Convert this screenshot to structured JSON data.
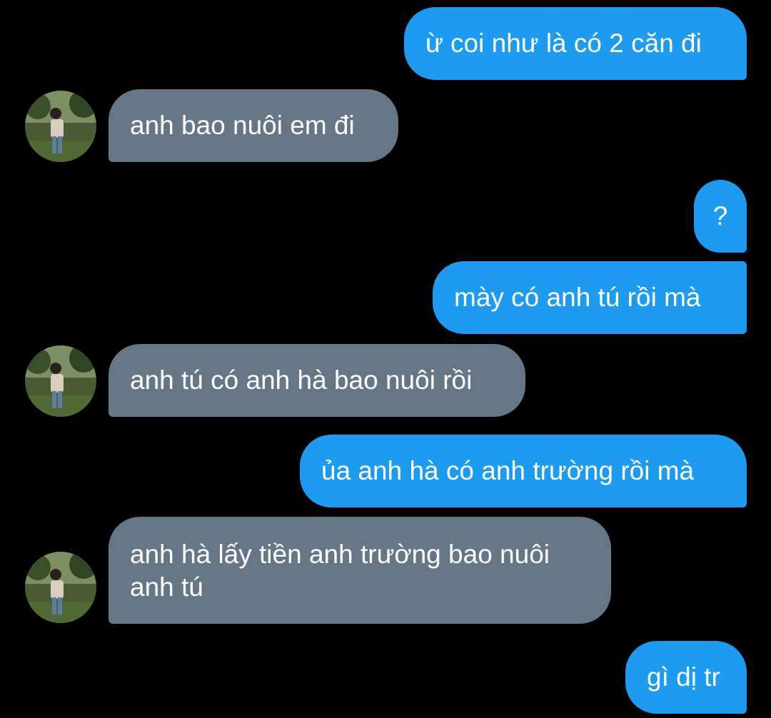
{
  "colors": {
    "background": "#000000",
    "outgoing_bubble": "#1d9bf0",
    "incoming_bubble": "#657686",
    "text": "#ffffff"
  },
  "messages": [
    {
      "direction": "outgoing",
      "text": "ừ coi như là có 2 căn đi"
    },
    {
      "direction": "incoming",
      "text": "anh bao nuôi em đi",
      "avatar": "user-avatar"
    },
    {
      "direction": "outgoing",
      "text": "?"
    },
    {
      "direction": "outgoing",
      "text": "mày có anh tú rồi mà"
    },
    {
      "direction": "incoming",
      "text": "anh tú có anh hà bao nuôi rồi",
      "avatar": "user-avatar"
    },
    {
      "direction": "outgoing",
      "text": "ủa anh hà có anh trường rồi mà"
    },
    {
      "direction": "incoming",
      "lines": [
        "anh hà lấy tiền anh trường bao nuôi",
        "anh tú"
      ],
      "avatar": "user-avatar"
    },
    {
      "direction": "outgoing",
      "text": "gì dị tr"
    }
  ]
}
